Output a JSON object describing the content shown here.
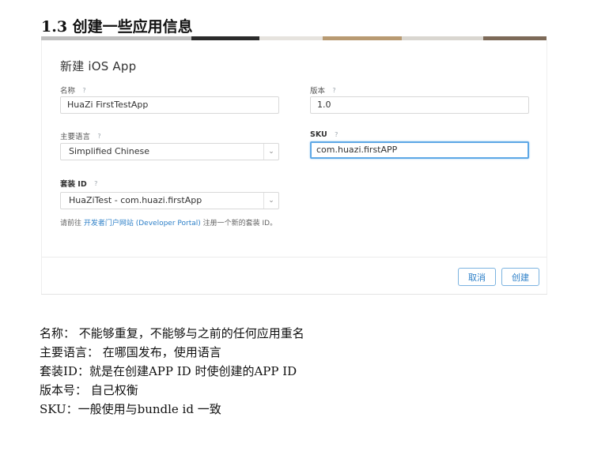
{
  "heading": "1.3 创建一些应用信息",
  "dialog": {
    "title": "新建 iOS App",
    "help_glyph": "?",
    "name": {
      "label": "名称",
      "value": "HuaZi FirstTestApp"
    },
    "version": {
      "label": "版本",
      "value": "1.0"
    },
    "language": {
      "label": "主要语言",
      "value": "Simplified Chinese"
    },
    "sku": {
      "label": "SKU",
      "value": "com.huazi.firstAPP"
    },
    "bundle": {
      "label": "套装 ID",
      "value": "HuaZiTest - com.huazi.firstApp"
    },
    "note": {
      "prefix": "请前往 ",
      "link": "开发者门户网站 (Developer Portal)",
      "suffix": " 注册一个新的套装 ID。"
    },
    "cancel_label": "取消",
    "create_label": "创建"
  },
  "notes": [
    "名称： 不能够重复，不能够与之前的任何应用重名",
    "主要语言： 在哪国发布，使用语言",
    "套装ID：就是在创建APP ID 时使创建的APP ID",
    "版本号： 自己权衡",
    "SKU：一般使用与bundle id 一致"
  ]
}
